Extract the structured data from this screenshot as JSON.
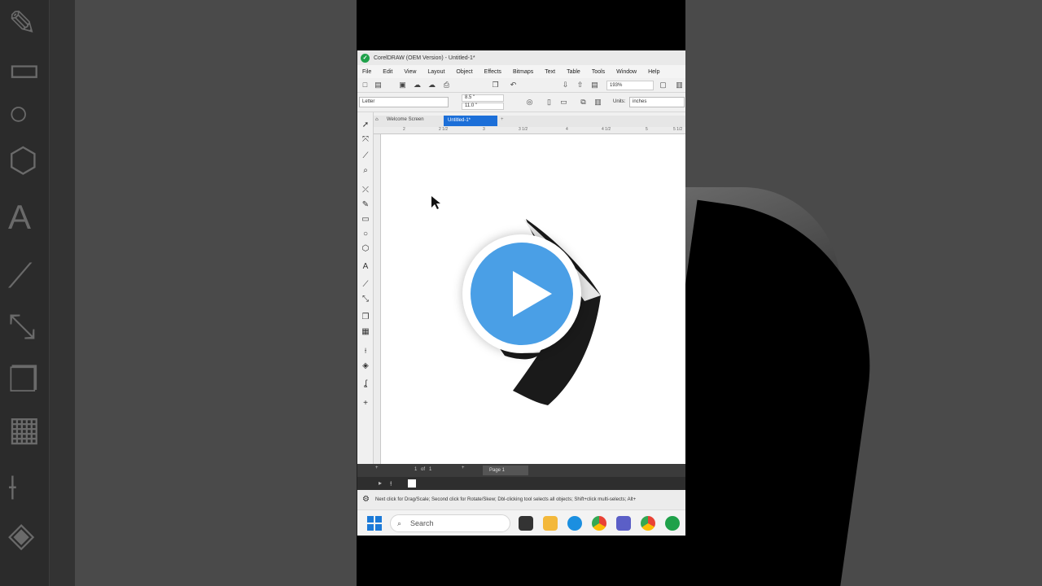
{
  "window": {
    "title": "CorelDRAW (OEM Version) - Untitled-1*"
  },
  "menu": [
    "File",
    "Edit",
    "View",
    "Layout",
    "Object",
    "Effects",
    "Bitmaps",
    "Text",
    "Table",
    "Tools",
    "Window",
    "Help"
  ],
  "toolbar": {
    "zoom": "193%"
  },
  "property_bar": {
    "paper": "Letter",
    "width": "8.5 \"",
    "height": "11.0 \"",
    "units_label": "Units:",
    "units": "inches"
  },
  "tabs": {
    "welcome": "Welcome Screen",
    "document": "Untitled-1*"
  },
  "ruler_h": [
    "2",
    "2 1/2",
    "3",
    "3 1/2",
    "4",
    "4 1/2",
    "5",
    "5 1/2"
  ],
  "page_nav": {
    "current": "1",
    "of": "of",
    "total": "1",
    "page_label": "Page 1"
  },
  "status": {
    "hint": "Next click for Drag/Scale; Second click for Rotate/Skew; Dbl-clicking tool selects all objects; Shift+click multi-selects; Alt+"
  },
  "taskbar": {
    "search": "Search"
  },
  "colors": {
    "accent": "#1c6fd8",
    "play_blue": "#4a9fe6",
    "corel_green": "#1fa14a"
  }
}
